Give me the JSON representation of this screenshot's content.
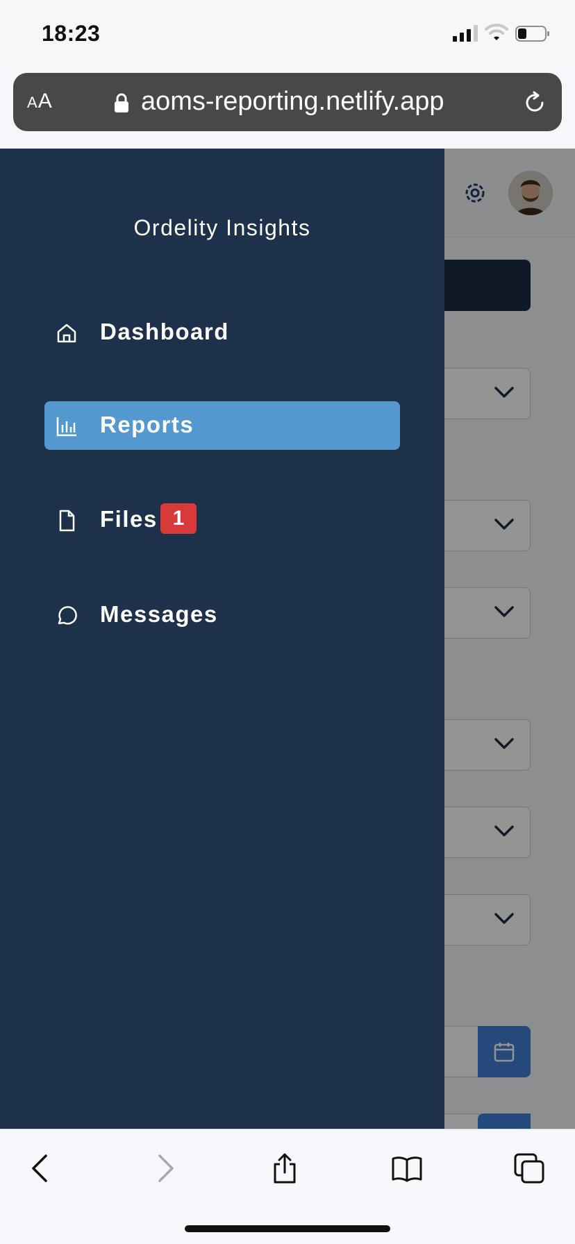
{
  "status_bar": {
    "time": "18:23"
  },
  "browser": {
    "aa_label": {
      "small": "A",
      "large": "A"
    },
    "url": "aoms-reporting.netlify.app"
  },
  "drawer": {
    "title": "Ordelity Insights",
    "items": [
      {
        "label": "Dashboard",
        "icon": "home-icon",
        "active": false
      },
      {
        "label": "Reports",
        "icon": "bar-chart-icon",
        "active": true
      },
      {
        "label": "Files",
        "icon": "file-icon",
        "active": false,
        "badge": "1"
      },
      {
        "label": "Messages",
        "icon": "message-icon",
        "active": false
      }
    ]
  },
  "colors": {
    "drawer_bg": "#1e314b",
    "active_item": "#5399cf",
    "badge": "#d83a3a",
    "date_button": "#3f7fd3"
  },
  "icons": [
    "gear-icon",
    "avatar",
    "chevron-down-icon",
    "calendar-icon",
    "back-icon",
    "forward-icon",
    "share-icon",
    "bookmarks-icon",
    "tabs-icon"
  ]
}
